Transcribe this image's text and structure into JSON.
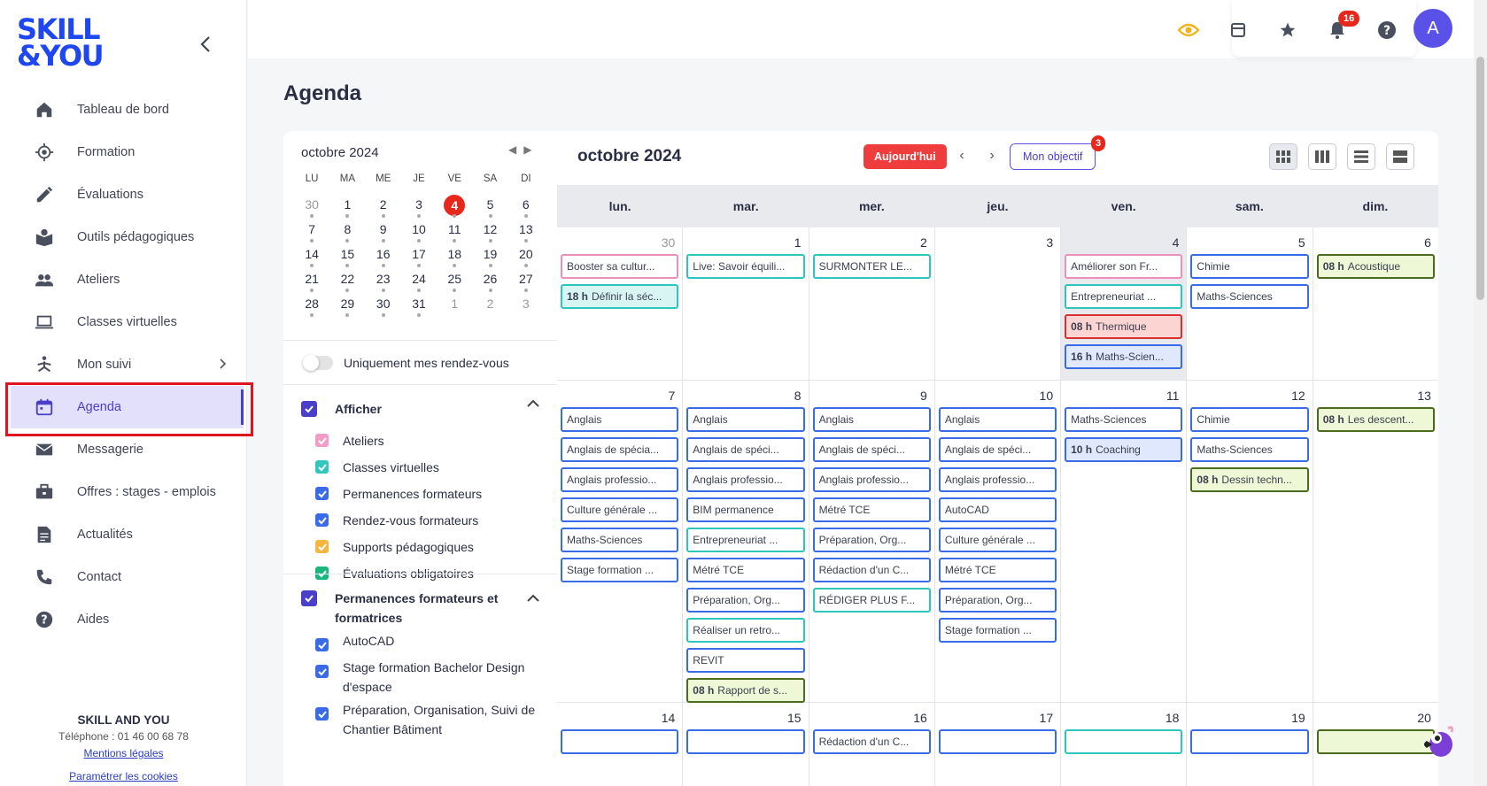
{
  "brand": {
    "line1": "SKILL",
    "line2": "&YOU"
  },
  "sidebar": {
    "items": [
      {
        "label": "Tableau de bord",
        "icon": "home-icon"
      },
      {
        "label": "Formation",
        "icon": "target-icon"
      },
      {
        "label": "Évaluations",
        "icon": "pencil-icon"
      },
      {
        "label": "Outils pédagogiques",
        "icon": "book-icon"
      },
      {
        "label": "Ateliers",
        "icon": "group-icon"
      },
      {
        "label": "Classes virtuelles",
        "icon": "laptop-icon"
      },
      {
        "label": "Mon suivi",
        "icon": "yoga-icon"
      },
      {
        "label": "Agenda",
        "icon": "calendar-icon"
      },
      {
        "label": "Messagerie",
        "icon": "mail-icon"
      },
      {
        "label": "Offres : stages - emplois",
        "icon": "briefcase-icon"
      },
      {
        "label": "Actualités",
        "icon": "article-icon"
      },
      {
        "label": "Contact",
        "icon": "phone-icon"
      },
      {
        "label": "Aides",
        "icon": "help-icon"
      }
    ],
    "footer": {
      "company": "SKILL AND YOU",
      "phone": "Téléphone : 01 46 00 68 78",
      "legal": "Mentions légales",
      "cookies": "Paramétrer les cookies"
    }
  },
  "topbar": {
    "notifications_count": "16",
    "avatar_letter": "A"
  },
  "page": {
    "title": "Agenda"
  },
  "mini_calendar": {
    "month": "octobre 2024",
    "dow": [
      "LU",
      "MA",
      "ME",
      "JE",
      "VE",
      "SA",
      "DI"
    ],
    "weeks": [
      [
        "30",
        "1",
        "2",
        "3",
        "4",
        "5",
        "6"
      ],
      [
        "7",
        "8",
        "9",
        "10",
        "11",
        "12",
        "13"
      ],
      [
        "14",
        "15",
        "16",
        "17",
        "18",
        "19",
        "20"
      ],
      [
        "21",
        "22",
        "23",
        "24",
        "25",
        "26",
        "27"
      ],
      [
        "28",
        "29",
        "30",
        "31",
        "1",
        "2",
        "3"
      ]
    ],
    "today": "4"
  },
  "filters": {
    "only_mine": "Uniquement mes rendez-vous",
    "afficher": {
      "title": "Afficher",
      "items": [
        {
          "label": "Ateliers",
          "color": "#f29bc6"
        },
        {
          "label": "Classes virtuelles",
          "color": "#33c6bf"
        },
        {
          "label": "Permanences formateurs",
          "color": "#3a6be6"
        },
        {
          "label": "Rendez-vous formateurs",
          "color": "#3a6be6"
        },
        {
          "label": "Supports pédagogiques",
          "color": "#f3b63f"
        },
        {
          "label": "Évaluations obligatoires",
          "color": "#19b77d"
        }
      ]
    },
    "permanences": {
      "title": "Permanences formateurs et formatrices",
      "items": [
        {
          "label": "AutoCAD"
        },
        {
          "label": "Stage formation Bachelor Design d'espace"
        },
        {
          "label": "Préparation, Organisation, Suivi de Chantier Bâtiment"
        }
      ]
    }
  },
  "calendar": {
    "title": "octobre 2024",
    "today_button": "Aujourd'hui",
    "objective_button": "Mon objectif",
    "objective_badge": "3",
    "days": [
      "lun.",
      "mar.",
      "mer.",
      "jeu.",
      "ven.",
      "sam.",
      "dim."
    ],
    "weeks": [
      {
        "days": [
          {
            "num": "30",
            "out": true,
            "events": [
              {
                "title": "Booster sa cultur...",
                "style": "pink"
              },
              {
                "time": "18 h",
                "title": "Définir la séc...",
                "style": "teal-f"
              }
            ]
          },
          {
            "num": "1",
            "events": [
              {
                "title": "Live: Savoir équili...",
                "style": "teal"
              }
            ]
          },
          {
            "num": "2",
            "events": [
              {
                "title": "SURMONTER LE...",
                "style": "teal"
              }
            ]
          },
          {
            "num": "3",
            "events": []
          },
          {
            "num": "4",
            "today": true,
            "events": [
              {
                "title": "Améliorer son Fr...",
                "style": "pink"
              },
              {
                "title": "Entrepreneuriat ...",
                "style": "teal"
              },
              {
                "time": "08 h",
                "title": "Thermique",
                "style": "red-f"
              },
              {
                "time": "16 h",
                "title": "Maths-Scien...",
                "style": "blue-f"
              }
            ]
          },
          {
            "num": "5",
            "events": [
              {
                "title": "Chimie",
                "style": "blue"
              },
              {
                "title": "Maths-Sciences",
                "style": "blue"
              }
            ]
          },
          {
            "num": "6",
            "events": [
              {
                "time": "08 h",
                "title": "Acoustique",
                "style": "green-f"
              }
            ]
          }
        ]
      },
      {
        "days": [
          {
            "num": "7",
            "events": [
              {
                "title": "Anglais",
                "style": "blue"
              },
              {
                "title": "Anglais de spécia...",
                "style": "blue"
              },
              {
                "title": "Anglais professio...",
                "style": "blue"
              },
              {
                "title": "Culture générale ...",
                "style": "blue"
              },
              {
                "title": "Maths-Sciences",
                "style": "blue"
              },
              {
                "title": "Stage formation ...",
                "style": "blue"
              }
            ]
          },
          {
            "num": "8",
            "events": [
              {
                "title": "Anglais",
                "style": "blue"
              },
              {
                "title": "Anglais de spéci...",
                "style": "blue"
              },
              {
                "title": "Anglais professio...",
                "style": "blue"
              },
              {
                "title": "BIM permanence",
                "style": "blue"
              },
              {
                "title": "Entrepreneuriat ...",
                "style": "teal"
              },
              {
                "title": "Métré TCE",
                "style": "blue"
              },
              {
                "title": "Préparation, Org...",
                "style": "blue"
              },
              {
                "title": "Réaliser un retro...",
                "style": "teal"
              },
              {
                "title": "REVIT",
                "style": "blue"
              },
              {
                "time": "08 h",
                "title": "Rapport de s...",
                "style": "green-f"
              }
            ]
          },
          {
            "num": "9",
            "events": [
              {
                "title": "Anglais",
                "style": "blue"
              },
              {
                "title": "Anglais de spéci...",
                "style": "blue"
              },
              {
                "title": "Anglais professio...",
                "style": "blue"
              },
              {
                "title": "Métré TCE",
                "style": "blue"
              },
              {
                "title": "Préparation, Org...",
                "style": "blue"
              },
              {
                "title": "Rédaction d'un C...",
                "style": "blue"
              },
              {
                "title": "RÉDIGER PLUS F...",
                "style": "teal"
              }
            ]
          },
          {
            "num": "10",
            "events": [
              {
                "title": "Anglais",
                "style": "blue"
              },
              {
                "title": "Anglais de spéci...",
                "style": "blue"
              },
              {
                "title": "Anglais professio...",
                "style": "blue"
              },
              {
                "title": "AutoCAD",
                "style": "blue"
              },
              {
                "title": "Culture générale ...",
                "style": "blue"
              },
              {
                "title": "Métré TCE",
                "style": "blue"
              },
              {
                "title": "Préparation, Org...",
                "style": "blue"
              },
              {
                "title": "Stage formation ...",
                "style": "blue"
              }
            ]
          },
          {
            "num": "11",
            "events": [
              {
                "title": "Maths-Sciences",
                "style": "blue"
              },
              {
                "time": "10 h",
                "title": "Coaching",
                "style": "blue-f"
              }
            ]
          },
          {
            "num": "12",
            "events": [
              {
                "title": "Chimie",
                "style": "blue"
              },
              {
                "title": "Maths-Sciences",
                "style": "blue"
              },
              {
                "time": "08 h",
                "title": "Dessin techn...",
                "style": "green-f"
              }
            ]
          },
          {
            "num": "13",
            "events": [
              {
                "time": "08 h",
                "title": "Les descent...",
                "style": "green-f"
              }
            ]
          }
        ]
      },
      {
        "days": [
          {
            "num": "14",
            "events": [
              {
                "title": "",
                "style": "blue"
              }
            ]
          },
          {
            "num": "15",
            "events": [
              {
                "title": "",
                "style": "blue"
              }
            ]
          },
          {
            "num": "16",
            "events": [
              {
                "title": "Rédaction d'un C...",
                "style": "blue"
              }
            ]
          },
          {
            "num": "17",
            "events": [
              {
                "title": "",
                "style": "blue"
              }
            ]
          },
          {
            "num": "18",
            "events": [
              {
                "title": "",
                "style": "teal"
              }
            ]
          },
          {
            "num": "19",
            "events": [
              {
                "title": "",
                "style": "blue"
              }
            ]
          },
          {
            "num": "20",
            "events": [
              {
                "title": "",
                "style": "green-f"
              }
            ]
          }
        ]
      }
    ]
  }
}
